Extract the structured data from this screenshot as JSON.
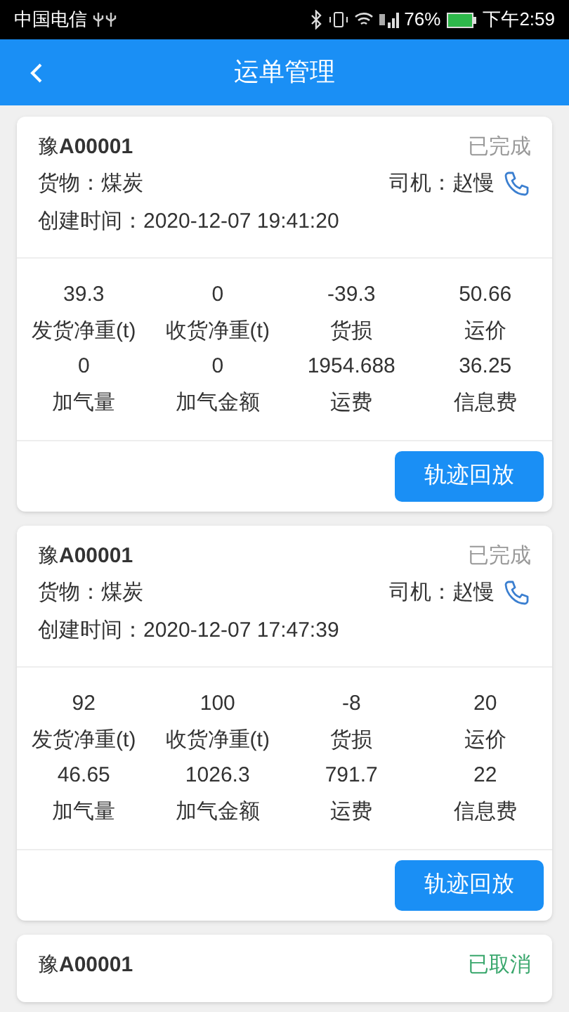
{
  "status_bar": {
    "carrier": "中国电信",
    "battery_percent": "76%",
    "time": "下午2:59"
  },
  "header": {
    "title": "运单管理"
  },
  "orders": [
    {
      "plate": "豫**A00001**",
      "status": "已完成",
      "color": "#999999",
      "cargo": "货物：煤炭",
      "driver": "司机：赵慢",
      "created": "创建时间：2020-12-07 19:41:20",
      "stats": [
        {
          "value": "39.3",
          "label": "发货净重(t)"
        },
        {
          "value": "0",
          "label": "收货净重(t)"
        },
        {
          "value": "-39.3",
          "label": "货损"
        },
        {
          "value": "50.66",
          "label": "运价"
        },
        {
          "value": "0",
          "label": "加气量"
        },
        {
          "value": "0",
          "label": "加气金额"
        },
        {
          "value": "1954.688",
          "label": "运费"
        },
        {
          "value": "36.25",
          "label": "信息费"
        }
      ],
      "button": "轨迹回放"
    },
    {
      "plate": "豫**A00001**",
      "status": "已完成",
      "color": "#999999",
      "cargo": "货物：煤炭",
      "driver": "司机：赵慢",
      "created": "创建时间：2020-12-07 17:47:39",
      "stats": [
        {
          "value": "92",
          "label": "发货净重(t)"
        },
        {
          "value": "100",
          "label": "收货净重(t)"
        },
        {
          "value": "-8",
          "label": "货损"
        },
        {
          "value": "20",
          "label": "运价"
        },
        {
          "value": "46.65",
          "label": "加气量"
        },
        {
          "value": "1026.3",
          "label": "加气金额"
        },
        {
          "value": "791.7",
          "label": "运费"
        },
        {
          "value": "22",
          "label": "信息费"
        }
      ],
      "button": "轨迹回放"
    },
    {
      "plate": "豫**A00001**",
      "status": "已取消",
      "color": "#3aa76d"
    }
  ]
}
